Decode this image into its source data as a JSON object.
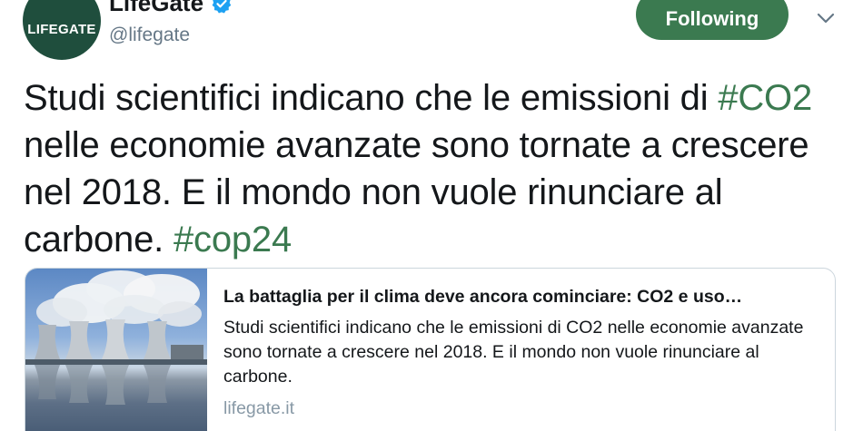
{
  "header": {
    "avatar_text": "LIFEGATE",
    "display_name": "LifeGate",
    "handle": "@lifegate",
    "follow_label": "Following"
  },
  "tweet": {
    "segments": [
      {
        "text": "Studi scientifici indicano che le emissioni di ",
        "type": "text"
      },
      {
        "text": "#CO2",
        "type": "hashtag"
      },
      {
        "text": " nelle economie avanzate sono tornate a crescere nel 2018. E il mondo non vuole rinunciare al carbone. ",
        "type": "text"
      },
      {
        "text": "#cop24",
        "type": "hashtag"
      }
    ]
  },
  "card": {
    "title": "La battaglia per il clima deve ancora cominciare: CO2 e uso…",
    "description": "Studi scientifici indicano che le emissioni di CO2 nelle economie avanzate sono tornate a crescere nel 2018. E il mondo non vuole rinunciare al carbone.",
    "domain": "lifegate.it"
  },
  "colors": {
    "brand_green": "#3b7a50",
    "avatar_green": "#1f4e3d",
    "verified_blue": "#1da1f2"
  },
  "icons": {
    "verified": "verified-badge-icon",
    "menu": "chevron-down-icon"
  }
}
